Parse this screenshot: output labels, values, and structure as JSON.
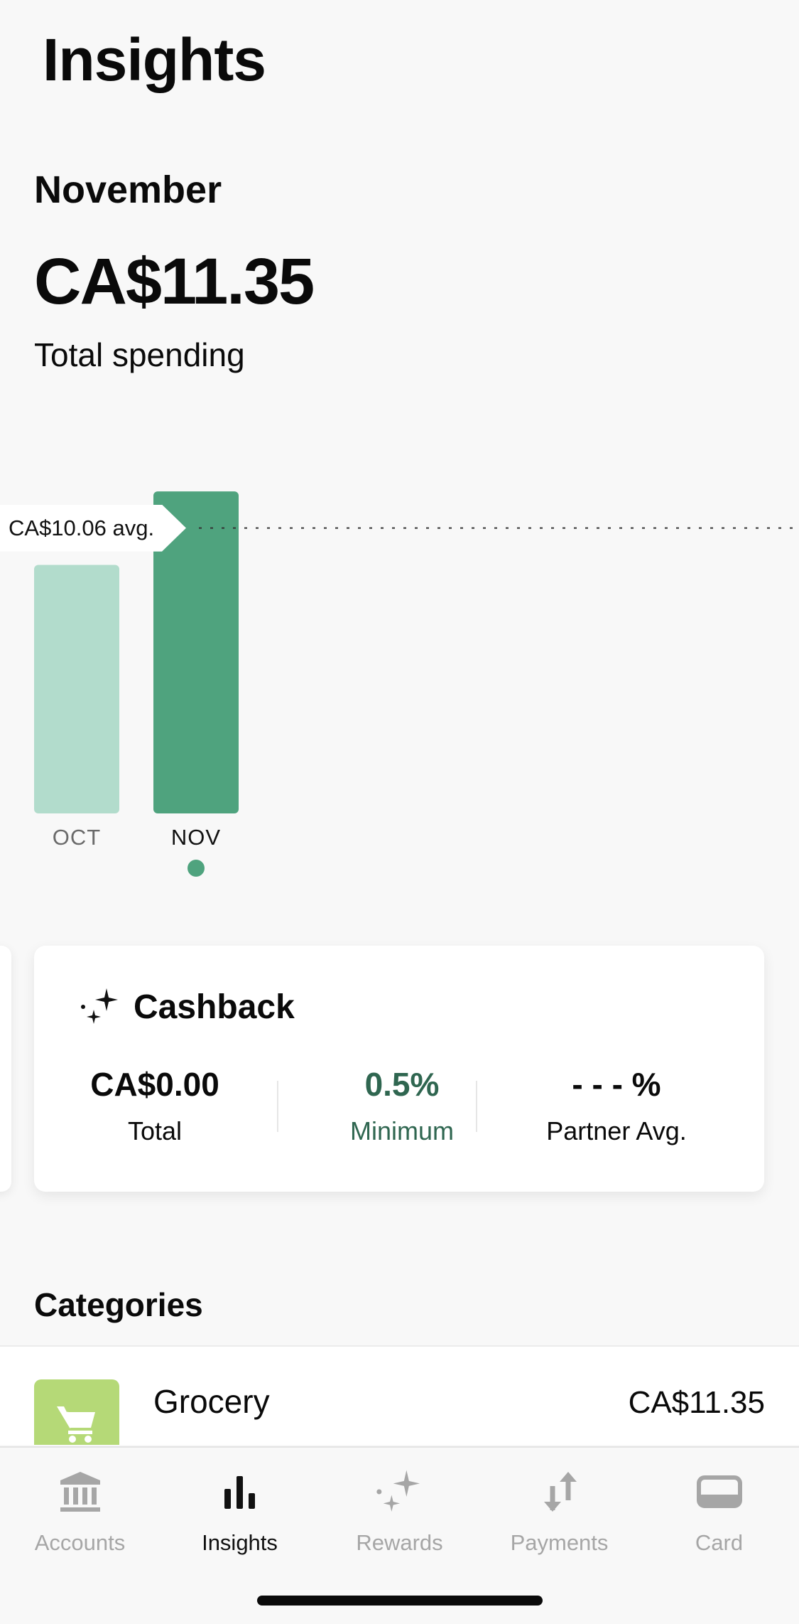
{
  "header": {
    "title": "Insights"
  },
  "summary": {
    "month": "November",
    "total": "CA$11.35",
    "total_label": "Total spending"
  },
  "chart_data": {
    "type": "bar",
    "categories": [
      "OCT",
      "NOV"
    ],
    "values": [
      8.76,
      11.35
    ],
    "average": 10.06,
    "average_label": "CA$10.06 avg.",
    "selected": "NOV",
    "colors": {
      "unselected": "#b2dccc",
      "selected": "#4fa37e"
    }
  },
  "cashback": {
    "title": "Cashback",
    "stats": [
      {
        "value": "CA$0.00",
        "caption": "Total"
      },
      {
        "value": "0.5%",
        "caption": "Minimum"
      },
      {
        "value": "- - - %",
        "caption": "Partner Avg."
      }
    ],
    "accent": "#2f6650"
  },
  "categories": {
    "title": "Categories",
    "items": [
      {
        "name": "Grocery",
        "amount": "CA$11.35",
        "icon": "shopping-cart-icon"
      }
    ]
  },
  "tabs": [
    {
      "label": "Accounts",
      "icon": "bank-icon",
      "active": false
    },
    {
      "label": "Insights",
      "icon": "bar-chart-icon",
      "active": true
    },
    {
      "label": "Rewards",
      "icon": "sparkle-icon",
      "active": false
    },
    {
      "label": "Payments",
      "icon": "transfer-arrows-icon",
      "active": false
    },
    {
      "label": "Card",
      "icon": "card-icon",
      "active": false
    }
  ]
}
